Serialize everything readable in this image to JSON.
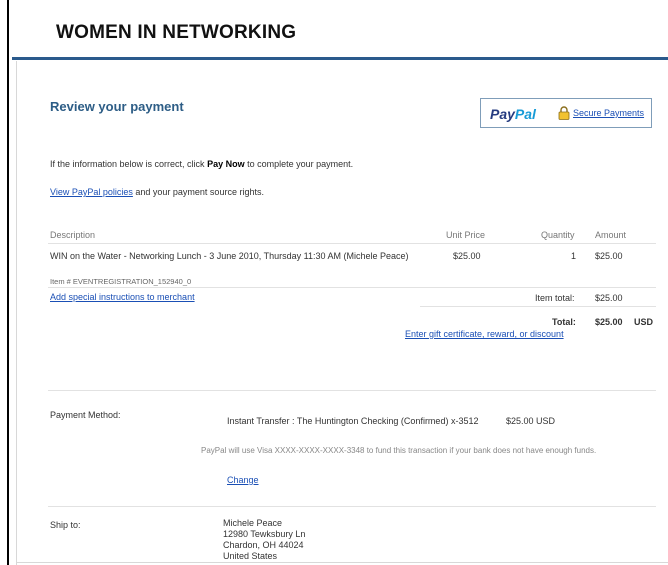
{
  "header": {
    "org_title": "WOMEN IN NETWORKING"
  },
  "review": {
    "title": "Review your payment"
  },
  "paypal_badge": {
    "logo_pay": "Pay",
    "logo_pal": "Pal",
    "secure_link": "Secure Payments",
    "lock_icon": "lock-icon"
  },
  "intro": {
    "prefix": "If the information below is correct, click ",
    "bold": "Pay Now",
    "suffix": " to complete your payment."
  },
  "policy": {
    "link": "View PayPal policies",
    "suffix": " and your payment source rights."
  },
  "table": {
    "headers": {
      "description": "Description",
      "unit_price": "Unit Price",
      "quantity": "Quantity",
      "amount": "Amount"
    },
    "item": {
      "description": "WIN on the Water - Networking Lunch - 3 June 2010, Thursday 11:30 AM (Michele Peace)",
      "item_number": "Item # EVENTREGISTRATION_152940_0",
      "unit_price": "$25.00",
      "quantity": "1",
      "amount": "$25.00"
    },
    "special_instructions_link": "Add special instructions to merchant",
    "item_total_label": "Item total:",
    "item_total_value": "$25.00",
    "total_label": "Total:",
    "total_value": "$25.00",
    "currency": "USD",
    "gift_link": "Enter gift certificate, reward, or discount"
  },
  "payment": {
    "label": "Payment Method:",
    "method": "Instant Transfer : The Huntington Checking (Confirmed) x-3512",
    "amount": "$25.00 USD",
    "note": "PayPal will use Visa XXXX-XXXX-XXXX-3348 to fund this transaction if your bank does not have enough funds.",
    "change_link": "Change"
  },
  "shipping": {
    "label": "Ship to:",
    "lines": [
      "Michele Peace",
      "12980 Tewksbury Ln",
      "Chardon, OH 44024",
      "United States"
    ]
  },
  "colors": {
    "accent_rule": "#2a5a8c",
    "heading": "#2d5d86",
    "link": "#1a4fb5"
  }
}
